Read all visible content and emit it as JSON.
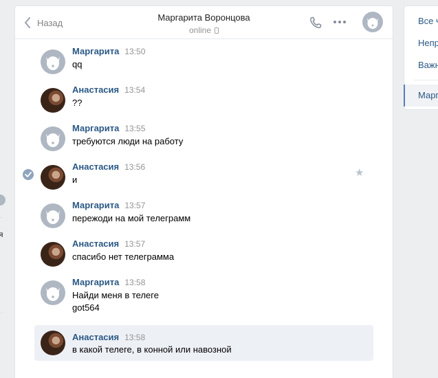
{
  "left_edge": {
    "glyph": "я"
  },
  "header": {
    "back_label": "Назад",
    "peer_name": "Маргарита Воронцова",
    "peer_status": "online",
    "icons": [
      "back-chevron-icon",
      "phone-icon",
      "more-icon",
      "avatar"
    ]
  },
  "messages": [
    {
      "author": "Маргарита",
      "time": "13:50",
      "text": "qq",
      "avatar": "default"
    },
    {
      "author": "Анастасия",
      "time": "13:54",
      "text": "??",
      "avatar": "photo"
    },
    {
      "author": "Маргарита",
      "time": "13:55",
      "text": "требуются люди на работу",
      "avatar": "default"
    },
    {
      "author": "Анастасия",
      "time": "13:56",
      "text": "и",
      "avatar": "photo"
    },
    {
      "author": "Маргарита",
      "time": "13:57",
      "text": "пережоди на мой телеграмм",
      "avatar": "default"
    },
    {
      "author": "Анастасия",
      "time": "13:57",
      "text": "спасибо нет телеграмма",
      "avatar": "photo"
    },
    {
      "author": "Маргарита",
      "time": "13:58",
      "text": "Найди меня в телеге\ngot564",
      "avatar": "default"
    },
    {
      "author": "Анастасия",
      "time": "13:58",
      "text": "в какой телеге, в конной или навозной",
      "avatar": "photo"
    }
  ],
  "filters": {
    "items": [
      "Все ч",
      "Непр",
      "Важн"
    ],
    "active": "Марг"
  },
  "colors": {
    "accent": "#2a5885",
    "background": "#edeef0",
    "selected_bg": "#edf0f5",
    "avatar_default": "#aeb7c2"
  }
}
